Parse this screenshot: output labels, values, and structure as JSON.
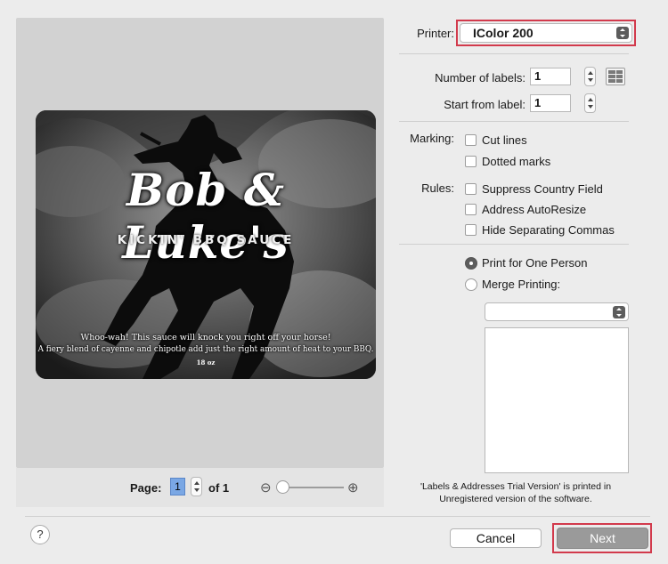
{
  "preview": {
    "label_title": "Bob & Luke's",
    "label_subtitle": "KICKIN' BBQ SAUCE",
    "label_line1": "Whoo-wah! This sauce will knock you right off your horse!",
    "label_line2": "A fiery blend of cayenne and chipotle add just the right amount of heat to your BBQ.",
    "label_size": "18 oz"
  },
  "pagebar": {
    "page_label": "Page:",
    "page_value": "1",
    "of_text": "of 1",
    "zoom_level": 0
  },
  "settings": {
    "printer_label": "Printer:",
    "printer_value": "IColor 200",
    "num_labels_label": "Number of labels:",
    "num_labels_value": "1",
    "start_label": "Start from label:",
    "start_value": "1",
    "marking_label": "Marking:",
    "marking_options": [
      {
        "label": "Cut lines",
        "checked": false
      },
      {
        "label": "Dotted marks",
        "checked": false
      }
    ],
    "rules_label": "Rules:",
    "rules_options": [
      {
        "label": "Suppress Country Field",
        "checked": false
      },
      {
        "label": "Address AutoResize",
        "checked": false
      },
      {
        "label": "Hide Separating Commas",
        "checked": false
      }
    ],
    "print_one": "Print for One Person",
    "merge_printing": "Merge Printing:",
    "merge_select_value": "",
    "trial_note": "'Labels & Addresses Trial Version' is printed in Unregistered version of the software."
  },
  "buttons": {
    "help": "?",
    "cancel": "Cancel",
    "next": "Next"
  },
  "colors": {
    "highlight": "#d23a4c",
    "page_selection": "#7aa7e4"
  },
  "icons": [
    "help-icon",
    "zoom-out-icon",
    "zoom-in-icon",
    "label-grid-icon",
    "stepper-icon",
    "select-arrows-icon"
  ]
}
